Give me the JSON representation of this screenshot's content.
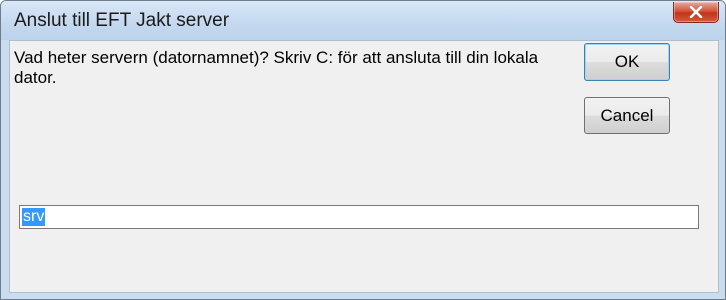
{
  "window": {
    "title": "Anslut till EFT Jakt server"
  },
  "titlebar": {
    "close_icon": "close-x-icon",
    "close_color": "#c7401f"
  },
  "prompt": {
    "message": "Vad heter servern (datornamnet)? Skriv C: för att ansluta till din lokala dator."
  },
  "buttons": {
    "ok_label": "OK",
    "cancel_label": "Cancel"
  },
  "input": {
    "value": "srv",
    "selected": true,
    "selection_color": "#3399ff"
  }
}
